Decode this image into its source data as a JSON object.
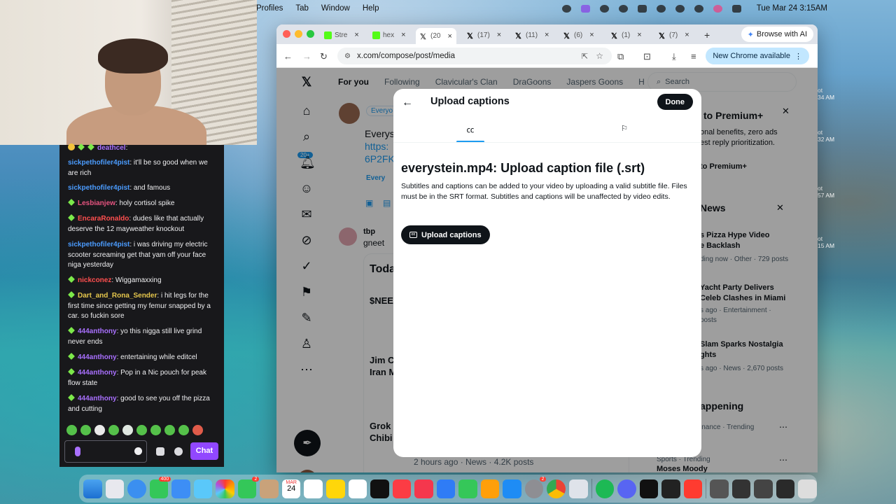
{
  "menubar": {
    "menus": [
      "Profiles",
      "Tab",
      "Window",
      "Help"
    ],
    "clock": "Tue Mar 24  3:15AM"
  },
  "chat": {
    "messages": [
      {
        "user": "deathcel",
        "text": "",
        "color": "#a970ff"
      },
      {
        "user": "sickpethofiler4pist",
        "text": "it'll be so good when we are rich",
        "color": "#4b9cff"
      },
      {
        "user": "sickpethofiler4pist",
        "text": "and famous",
        "color": "#4b9cff"
      },
      {
        "user": "Lesbianjew",
        "text": "holy cortisol spike",
        "color": "#e75480"
      },
      {
        "user": "EncaraRonaldo",
        "text": "dudes like that actually deserve the 12 mayweather knockout",
        "color": "#ff4f4f"
      },
      {
        "user": "sickpethofiler4pist",
        "text": "i was driving my electric scooter screaming get that yam off your face niga yesterday",
        "color": "#4b9cff"
      },
      {
        "user": "nickconez",
        "text": "Wiggamaxxing",
        "color": "#ff4f4f"
      },
      {
        "user": "Dart_and_Rona_Sender",
        "text": "i hit legs for the first time since getting my femur snapped by a car. so fuckin sore",
        "color": "#e6c74c"
      },
      {
        "user": "444anthony",
        "text": "yo this nigga still live grind never ends",
        "color": "#a970ff"
      },
      {
        "user": "444anthony",
        "text": "entertaining while editcel",
        "color": "#a970ff"
      },
      {
        "user": "444anthony",
        "text": "Pop in a Nic pouch for peak flow state",
        "color": "#a970ff"
      },
      {
        "user": "444anthony",
        "text": "good to see you off the pizza and cutting",
        "color": "#a970ff"
      }
    ],
    "chat_button": "Chat"
  },
  "browser": {
    "tabs": [
      {
        "label": "Stre",
        "fav": "#53fc18"
      },
      {
        "label": "hex",
        "fav": "#53fc18"
      },
      {
        "label": "(20",
        "fav": "#000"
      },
      {
        "label": "(17)",
        "fav": "#000"
      },
      {
        "label": "(11)",
        "fav": "#000"
      },
      {
        "label": "(6)",
        "fav": "#000"
      },
      {
        "label": "(1)",
        "fav": "#000"
      },
      {
        "label": "(7)",
        "fav": "#000"
      }
    ],
    "ai_button": "Browse with AI",
    "url": "x.com/compose/post/media",
    "new_chrome": "New Chrome available"
  },
  "x": {
    "top_tabs": [
      "For you",
      "Following",
      "Clavicular's Clan",
      "DraGoons",
      "Jaspers Goons",
      "H"
    ],
    "search_placeholder": "Search",
    "badge": "20+",
    "feed": {
      "everyone": "Everyo",
      "draft": "Everys",
      "link1": "https:",
      "link2": "6P2FK",
      "reply_everyone": "Every",
      "author": "tbp",
      "author_sub": "gneet",
      "today": "Toda",
      "need": "$NEE",
      "jim": "Jim C",
      "iran": "Iran M",
      "grok": "Grok",
      "chibi": "Chibi",
      "time_meta": "2 hours ago · News · 4.2K posts"
    },
    "sidebar": {
      "premium_title": "to Premium+",
      "premium_desc1": "onal benefits, zero ads",
      "premium_desc2": "est reply prioritization.",
      "premium_btn": "to Premium+",
      "news_title": "News",
      "n1_title1": "s Pizza Hype Video",
      "n1_title2": "e Backlash",
      "n1_meta": "ding now · Other · 729 posts",
      "n2_title1": "Yacht Party Delivers",
      "n2_title2": "Celeb Clashes in Miami",
      "n2_meta1": "s ago · Entertainment ·",
      "n2_meta2": "posts",
      "n3_title1": "Slam Sparks Nostalgia",
      "n3_title2": "ghts",
      "n3_meta": "s ago · News · 2,670 posts",
      "happening": "appening",
      "trend1_meta": "inance · Trending",
      "trend2_meta": "Sports · Trending",
      "trend2_name": "Moses Moody"
    }
  },
  "modal": {
    "title": "Upload captions",
    "done": "Done",
    "heading": "everystein.mp4: Upload caption file (.srt)",
    "description": "Subtitles and captions can be added to your video by uploading a valid subtitle file. Files must be in the SRT format. Subtitles and captions will be unaffected by video edits.",
    "upload_button": "Upload captions"
  },
  "desktop_edge": [
    "ot",
    "34 AM",
    "ot",
    "32 AM",
    "ot",
    "57 AM",
    "ot",
    "15 AM"
  ],
  "dock": {
    "badge_mail": "400",
    "badge_messages": "2",
    "badge_settings": "2",
    "calendar_month": "MAR",
    "calendar_day": "24"
  }
}
